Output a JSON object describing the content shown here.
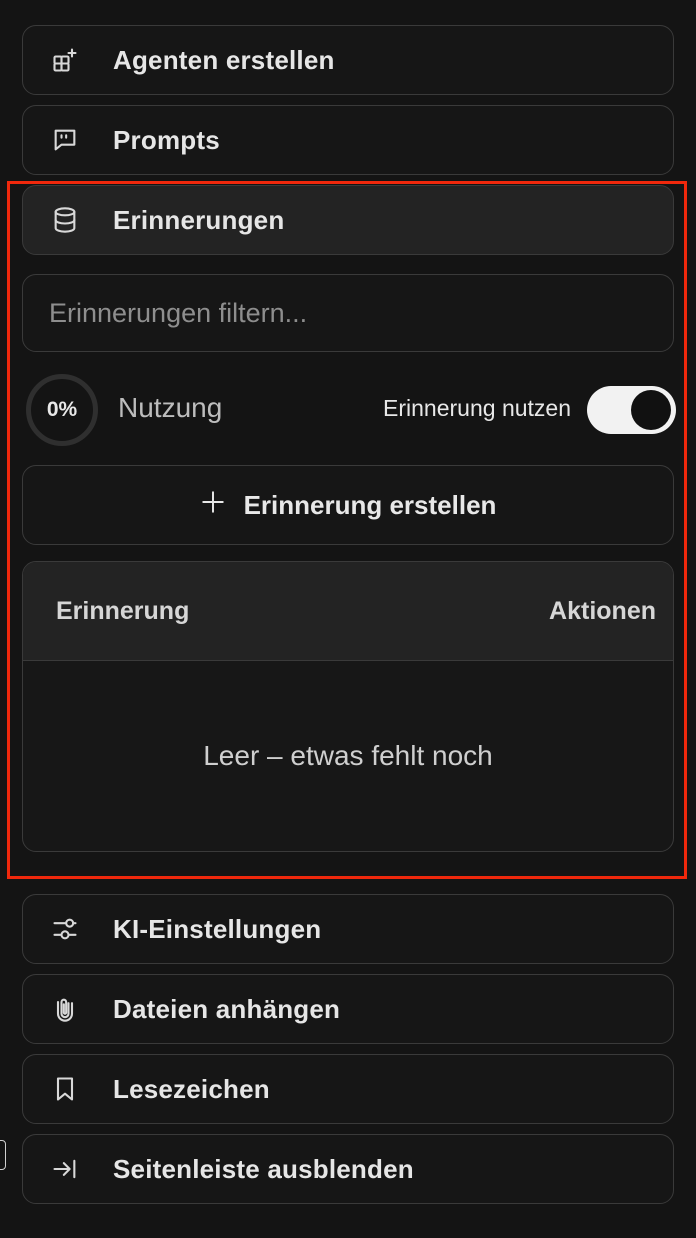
{
  "menu": {
    "create_agents": "Agenten erstellen",
    "prompts": "Prompts",
    "memories": "Erinnerungen",
    "ai_settings": "KI-Einstellungen",
    "attach_files": "Dateien anhängen",
    "bookmarks": "Lesezeichen",
    "hide_sidebar": "Seitenleiste ausblenden"
  },
  "memories_panel": {
    "filter_placeholder": "Erinnerungen filtern...",
    "filter_value": "",
    "usage_percent": "0%",
    "usage_label": "Nutzung",
    "toggle_label": "Erinnerung nutzen",
    "toggle_on": true,
    "create_button": "Erinnerung erstellen",
    "table": {
      "columns": [
        "Erinnerung",
        "Aktionen"
      ],
      "rows": [],
      "empty_text": "Leer – etwas fehlt noch"
    }
  },
  "colors": {
    "background": "#141414",
    "border": "#3a3a3a",
    "highlight": "#f0280c",
    "toggle_on": "#f2f2f2"
  },
  "icons": {
    "create_agents": "blocks-plus-icon",
    "prompts": "message-quote-icon",
    "memories": "database-icon",
    "ai_settings": "sliders-icon",
    "attach_files": "paperclip-icon",
    "bookmarks": "bookmark-icon",
    "hide_sidebar": "arrow-right-to-line-icon",
    "create": "plus-icon"
  }
}
